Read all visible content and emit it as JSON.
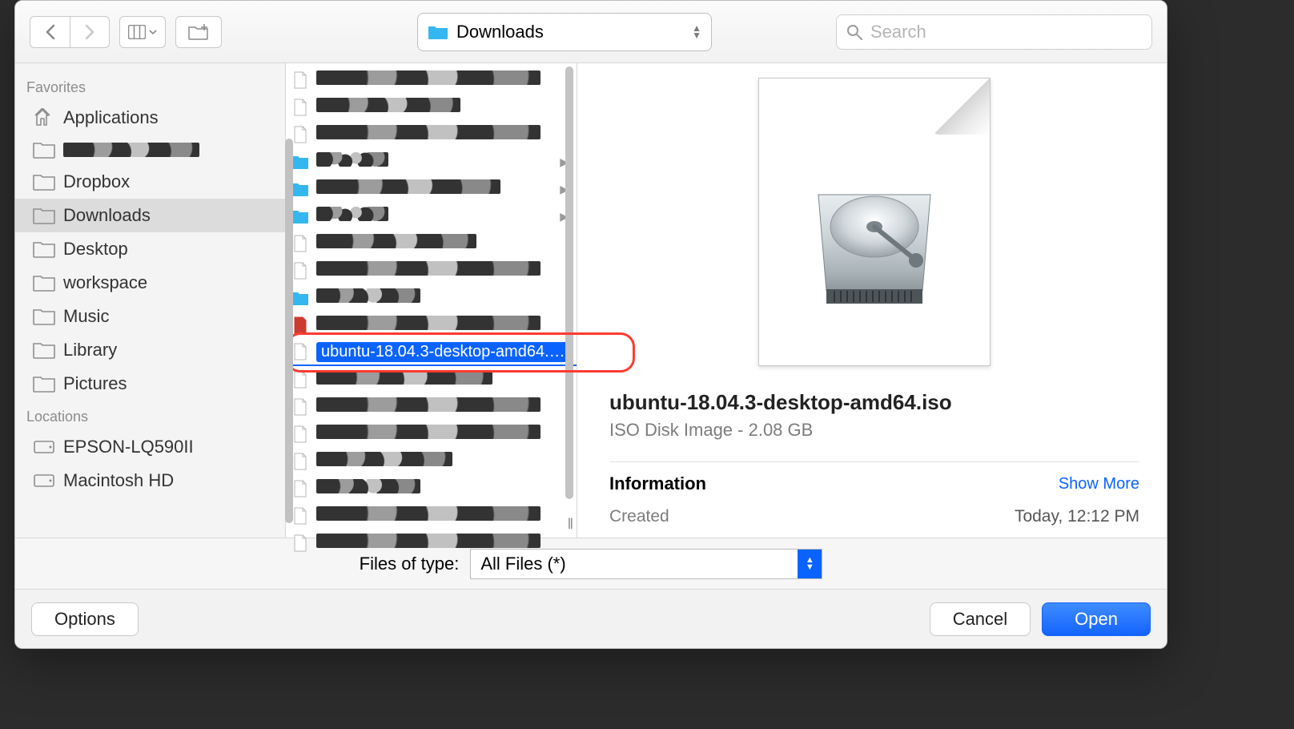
{
  "toolbar": {
    "location_label": "Downloads",
    "search_placeholder": "Search"
  },
  "sidebar": {
    "sections": [
      {
        "header": "Favorites",
        "items": [
          {
            "icon": "applications",
            "label": "Applications",
            "selected": false
          },
          {
            "icon": "folder",
            "label": "",
            "selected": false,
            "redacted": true,
            "redact_width": 170
          },
          {
            "icon": "folder",
            "label": "Dropbox",
            "selected": false
          },
          {
            "icon": "folder",
            "label": "Downloads",
            "selected": true
          },
          {
            "icon": "folder",
            "label": "Desktop",
            "selected": false
          },
          {
            "icon": "folder",
            "label": "workspace",
            "selected": false
          },
          {
            "icon": "folder",
            "label": "Music",
            "selected": false
          },
          {
            "icon": "folder",
            "label": "Library",
            "selected": false
          },
          {
            "icon": "folder",
            "label": "Pictures",
            "selected": false
          }
        ]
      },
      {
        "header": "Locations",
        "items": [
          {
            "icon": "hd",
            "label": "EPSON-LQ590II",
            "selected": false
          },
          {
            "icon": "hd",
            "label": "Macintosh HD",
            "selected": false
          }
        ]
      }
    ]
  },
  "file_list": {
    "highlight_index": 10,
    "items": [
      {
        "type": "file",
        "redacted": true,
        "redact_width": 280
      },
      {
        "type": "file",
        "redacted": true,
        "redact_width": 180
      },
      {
        "type": "file",
        "redacted": true,
        "redact_width": 280
      },
      {
        "type": "folder",
        "redacted": true,
        "redact_width": 90,
        "expandable": true
      },
      {
        "type": "folder",
        "redacted": true,
        "redact_width": 230,
        "expandable": true
      },
      {
        "type": "folder",
        "redacted": true,
        "redact_width": 90,
        "expandable": true
      },
      {
        "type": "file",
        "redacted": true,
        "redact_width": 200
      },
      {
        "type": "file",
        "redacted": true,
        "redact_width": 280
      },
      {
        "type": "folder",
        "icon_color": "#34b7f1",
        "redacted": true,
        "redact_width": 130
      },
      {
        "type": "file",
        "icon_color": "#cc3b2f",
        "redacted": true,
        "redact_width": 280
      },
      {
        "type": "file",
        "name": "ubuntu-18.04.3-desktop-amd64.iso",
        "selected": true
      },
      {
        "type": "file",
        "redacted": true,
        "redact_width": 220
      },
      {
        "type": "file",
        "redacted": true,
        "redact_width": 280
      },
      {
        "type": "file",
        "redacted": true,
        "redact_width": 280
      },
      {
        "type": "file",
        "redacted": true,
        "redact_width": 170
      },
      {
        "type": "file",
        "redacted": true,
        "redact_width": 130
      },
      {
        "type": "file",
        "redacted": true,
        "redact_width": 280
      },
      {
        "type": "file",
        "redacted": true,
        "redact_width": 280
      }
    ]
  },
  "preview": {
    "title": "ubuntu-18.04.3-desktop-amd64.iso",
    "subtitle": "ISO Disk Image - 2.08 GB",
    "section_title": "Information",
    "show_more": "Show More",
    "info": [
      {
        "k": "Created",
        "v": "Today, 12:12 PM"
      }
    ]
  },
  "typebar": {
    "label": "Files of type:",
    "value": "All Files (*)"
  },
  "footer": {
    "options": "Options",
    "cancel": "Cancel",
    "open": "Open"
  }
}
